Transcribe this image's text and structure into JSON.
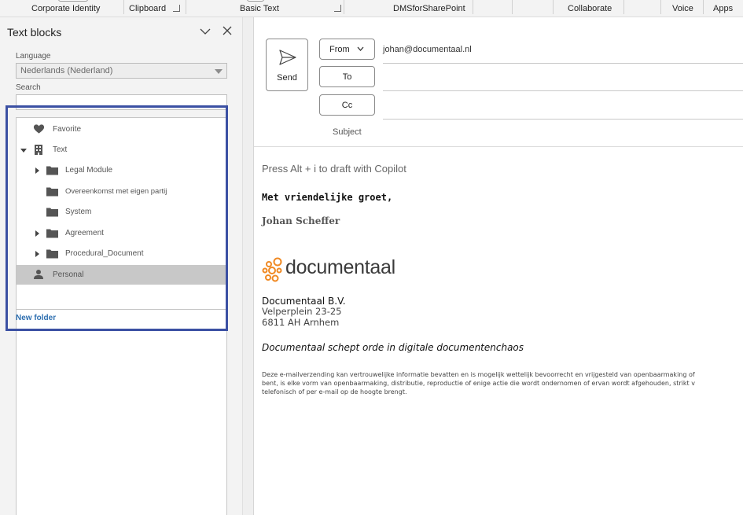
{
  "ribbon": {
    "groups": [
      "Corporate Identity",
      "Clipboard",
      "Basic Text",
      "DMSforSharePoint",
      "Collaborate",
      "Voice",
      "Apps"
    ]
  },
  "pane": {
    "title": "Text blocks",
    "language_label": "Language",
    "language_value": "Nederlands (Nederland)",
    "search_label": "Search",
    "search_value": "",
    "new_folder": "New folder",
    "tree": [
      {
        "label": "Favorite",
        "icon": "heart-icon"
      },
      {
        "label": "Text",
        "icon": "building-icon"
      },
      {
        "label": "Legal Module",
        "icon": "folder-icon"
      },
      {
        "label": "Overeenkomst met eigen partij",
        "icon": "folder-icon"
      },
      {
        "label": "System",
        "icon": "folder-icon"
      },
      {
        "label": "Agreement",
        "icon": "folder-icon"
      },
      {
        "label": "Procedural_Document",
        "icon": "folder-icon"
      },
      {
        "label": "Personal",
        "icon": "person-icon"
      }
    ]
  },
  "compose": {
    "send_label": "Send",
    "from_label": "From",
    "to_label": "To",
    "cc_label": "Cc",
    "from_address": "johan@documentaal.nl",
    "subject_label": "Subject",
    "copilot_hint": "Press Alt + i to draft with Copilot",
    "greeting": "Met vriendelijke groet,",
    "signature_name": "Johan Scheffer",
    "logo_text": "documentaal",
    "company": "Documentaal B.V.",
    "address_line1": "Velperplein 23-25",
    "address_line2": "6811 AH  Arnhem",
    "tagline": "Documentaal schept orde in digitale documentenchaos",
    "disclaimer_line1": "Deze e-mailverzending kan vertrouwelijke informatie bevatten en is mogelijk wettelijk bevoorrecht en vrijgesteld van openbaarmaking of",
    "disclaimer_line2": "bent, is elke vorm van openbaarmaking, distributie, reproductie of enige actie die wordt ondernomen of ervan wordt afgehouden, strikt v",
    "disclaimer_line3": "telefonisch of per e-mail op de hoogte brengt."
  },
  "colors": {
    "accent_highlight": "#3b50a3",
    "link": "#2e6fb0",
    "logo_orange": "#f08a24"
  }
}
